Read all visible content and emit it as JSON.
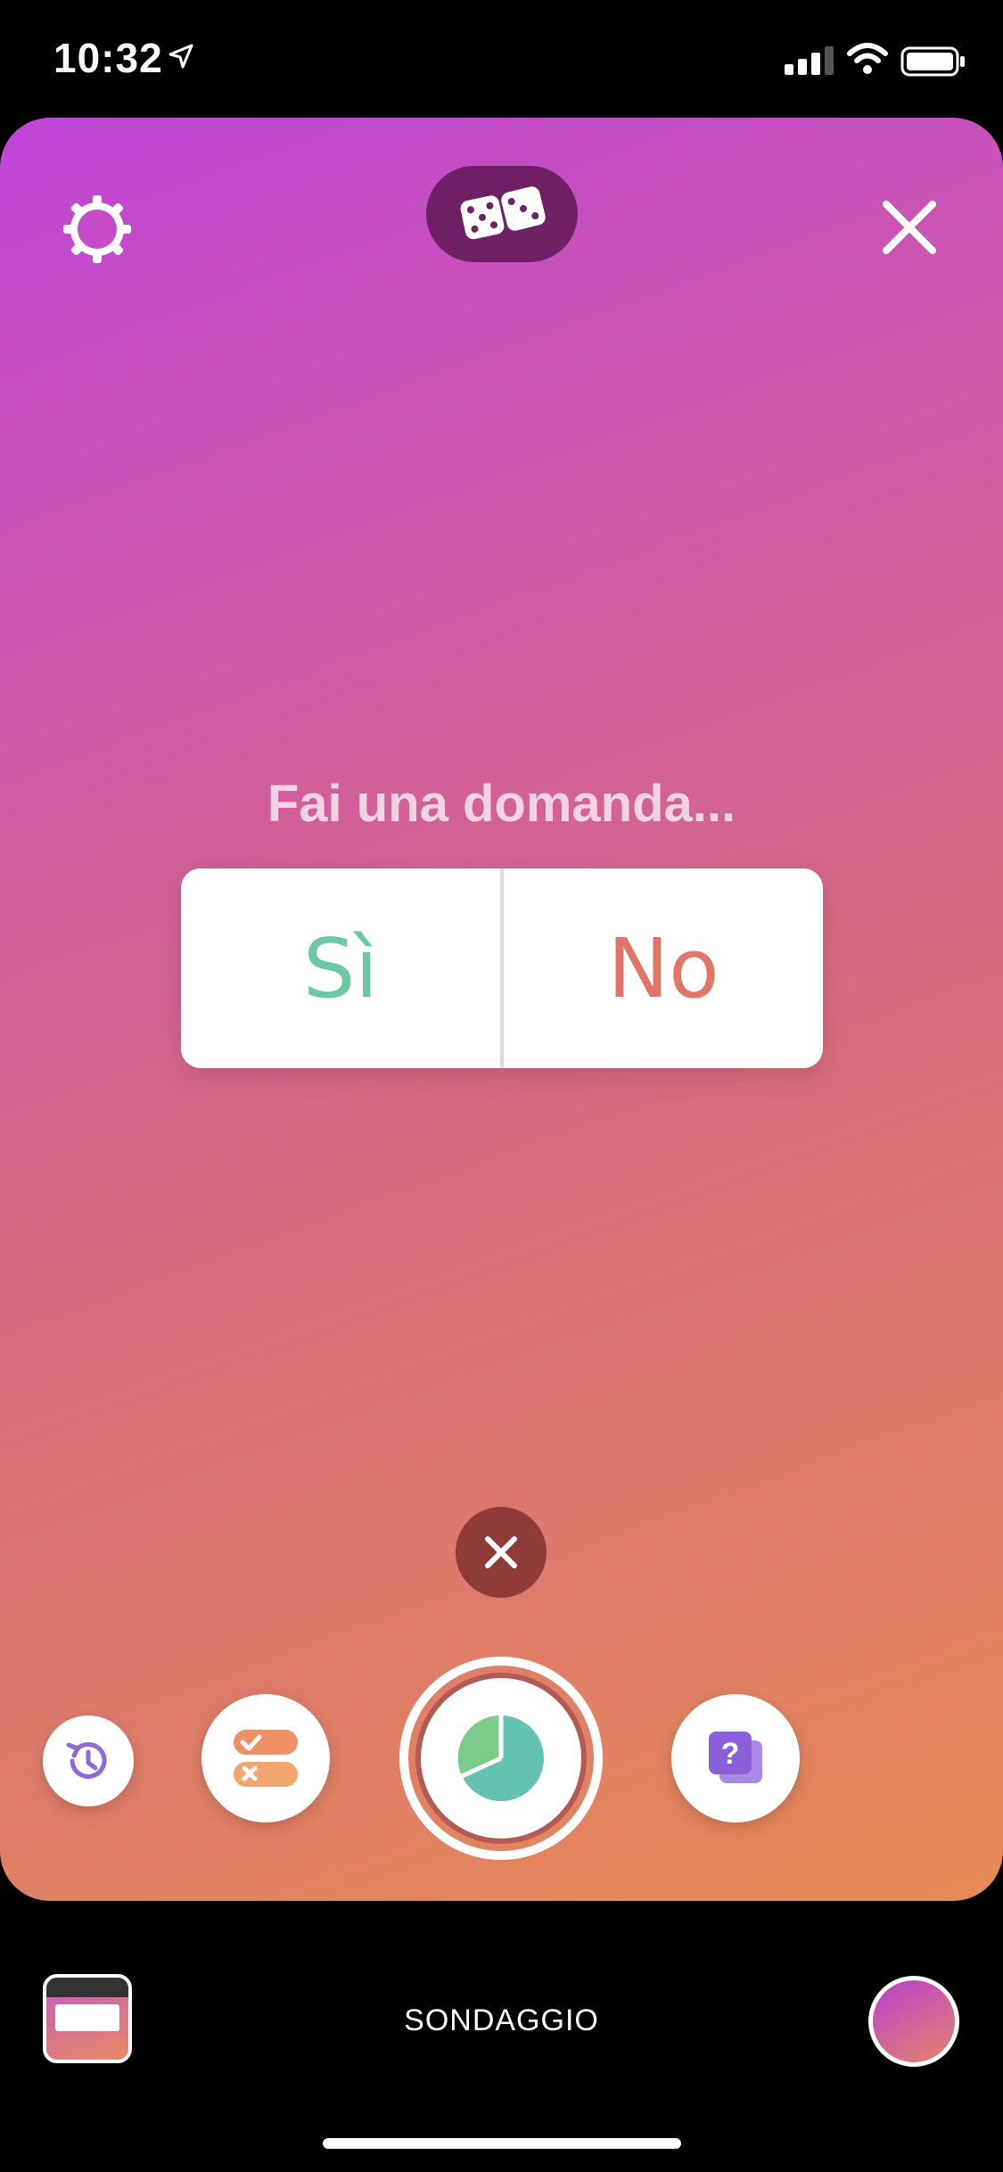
{
  "status_bar": {
    "time": "10:32"
  },
  "top_bar": {
    "settings": "settings-icon",
    "dice": "dice-icon",
    "close": "close-icon"
  },
  "poll_sticker": {
    "question_placeholder": "Fai una domanda...",
    "option_yes": "Sì",
    "option_no": "No",
    "colors": {
      "yes": "#6cc7a3",
      "no": "#e17567"
    }
  },
  "sticker_tray": [
    "history-icon",
    "quiz-icon",
    "poll-icon",
    "question-sticker-icon"
  ],
  "bottom_bar": {
    "mode_label": "SONDAGGIO"
  }
}
